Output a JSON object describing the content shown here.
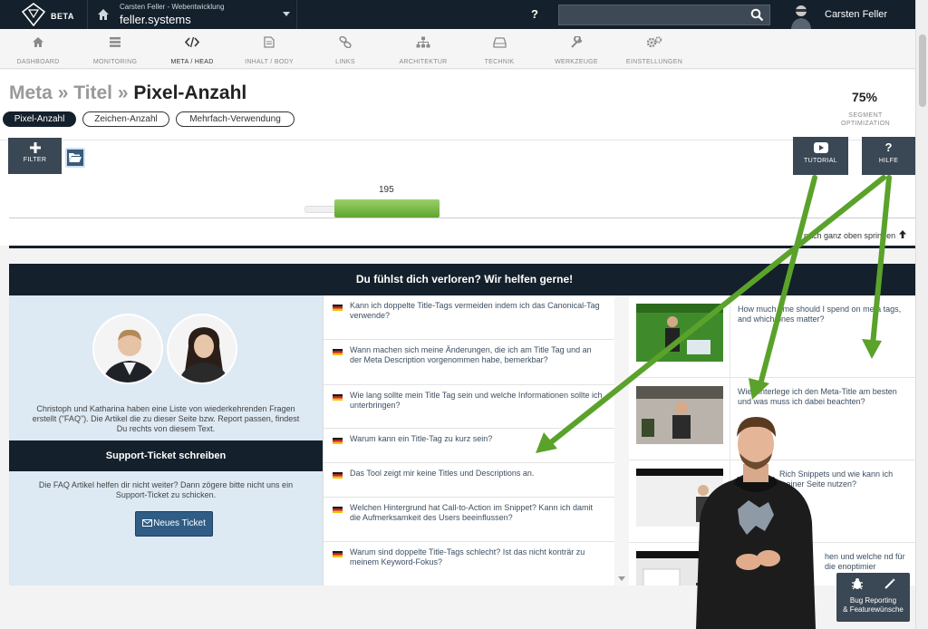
{
  "topbar": {
    "beta": "BETA",
    "account_sub": "Carsten Feller - Webentwicklung",
    "account_name": "feller.systems",
    "help": "?",
    "search_placeholder": "",
    "user_name": "Carsten Feller"
  },
  "nav": {
    "items": [
      {
        "label": "DASHBOARD",
        "icon": "home-icon"
      },
      {
        "label": "MONITORING",
        "icon": "list-icon"
      },
      {
        "label": "META / HEAD",
        "icon": "code-icon"
      },
      {
        "label": "INHALT / BODY",
        "icon": "document-icon"
      },
      {
        "label": "LINKS",
        "icon": "link-icon"
      },
      {
        "label": "ARCHITEKTUR",
        "icon": "sitemap-icon"
      },
      {
        "label": "TECHNIK",
        "icon": "hdd-icon"
      },
      {
        "label": "WERKZEUGE",
        "icon": "wrench-icon"
      },
      {
        "label": "EINSTELLUNGEN",
        "icon": "gears-icon"
      }
    ]
  },
  "breadcrumb": {
    "part1": "Meta",
    "sep1": " » ",
    "part2": "Titel",
    "sep2": " » ",
    "current": "Pixel-Anzahl"
  },
  "subtabs": [
    "Pixel-Anzahl",
    "Zeichen-Anzahl",
    "Mehrfach-Verwendung"
  ],
  "score": {
    "value": "75%",
    "label_line1": "SEGMENT",
    "label_line2": "OPTIMIZATION"
  },
  "toolbar": {
    "filter": "FILTER",
    "tutorial": "TUTORIAL",
    "hilfe": "HILFE"
  },
  "chart_data": {
    "type": "bar",
    "values": [
      195
    ],
    "data_labels": [
      "195"
    ]
  },
  "jump_top": "nach ganz oben springen",
  "help": {
    "header": "Du fühlst dich verloren? Wir helfen gerne!",
    "intro": "Christoph und Katharina haben eine Liste von wiederkehrenden Fragen erstellt (\"FAQ\"). Die Artikel die zu dieser Seite bzw. Report passen, findest Du rechts von diesem Text.",
    "ticket_header": "Support-Ticket schreiben",
    "ticket_text": "Die FAQ Artikel helfen dir nicht weiter? Dann zögere bitte nicht uns ein Support-Ticket zu schicken.",
    "ticket_button": "Neues Ticket"
  },
  "faq": [
    "Kann ich doppelte Title-Tags vermeiden indem ich das Canonical-Tag verwende?",
    "Wann machen sich meine Änderungen, die ich am Title Tag und an der Meta Description vorgenommen habe, bemerkbar?",
    "Wie lang sollte mein Title Tag sein und welche Informationen sollte ich unterbringen?",
    "Warum kann ein Title-Tag zu kurz sein?",
    "Das Tool zeigt mir keine Titles und Descriptions an.",
    "Welchen Hintergrund hat Call-to-Action im Snippet? Kann ich damit die Aufmerksamkeit des Users beeinflussen?",
    "Warum sind doppelte Title-Tags schlecht? Ist das nicht konträr zu meinem Keyword-Fokus?"
  ],
  "videos": [
    "How much time should I spend on meta tags, and which ones matter?",
    "Wie hinterlege ich den Meta-Title am besten und was muss ich dabei beachten?",
    "Rich Snippets und wie kann ich meiner Seite nutzen?",
    "hen und welche nd für die enoptimier"
  ],
  "bug": {
    "line1": "Bug Reporting",
    "line2": "& Featurewünsche"
  }
}
